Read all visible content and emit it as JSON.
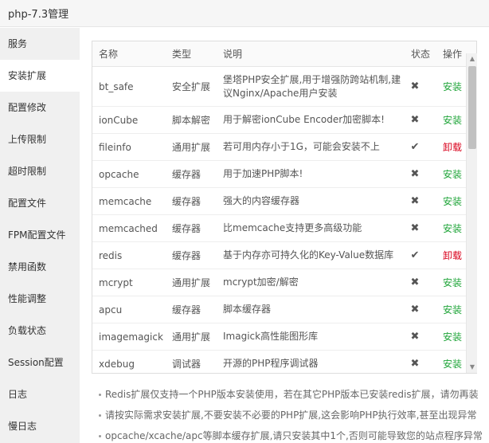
{
  "window": {
    "title": "php-7.3管理"
  },
  "sidebar": {
    "items": [
      {
        "label": "服务",
        "active": false
      },
      {
        "label": "安装扩展",
        "active": true
      },
      {
        "label": "配置修改",
        "active": false
      },
      {
        "label": "上传限制",
        "active": false
      },
      {
        "label": "超时限制",
        "active": false
      },
      {
        "label": "配置文件",
        "active": false
      },
      {
        "label": "FPM配置文件",
        "active": false
      },
      {
        "label": "禁用函数",
        "active": false
      },
      {
        "label": "性能调整",
        "active": false
      },
      {
        "label": "负载状态",
        "active": false
      },
      {
        "label": "Session配置",
        "active": false
      },
      {
        "label": "日志",
        "active": false
      },
      {
        "label": "慢日志",
        "active": false
      }
    ]
  },
  "table": {
    "headers": {
      "name": "名称",
      "type": "类型",
      "desc": "说明",
      "status": "状态",
      "op": "操作"
    },
    "rows": [
      {
        "name": "bt_safe",
        "type": "安全扩展",
        "desc": "堡塔PHP安全扩展,用于增强防跨站机制,建议Nginx/Apache用户安装",
        "status": "✖",
        "op": "安装",
        "installed": false
      },
      {
        "name": "ionCube",
        "type": "脚本解密",
        "desc": "用于解密ionCube Encoder加密脚本!",
        "status": "✖",
        "op": "安装",
        "installed": false
      },
      {
        "name": "fileinfo",
        "type": "通用扩展",
        "desc": "若可用内存小于1G，可能会安装不上",
        "status": "✔",
        "op": "卸载",
        "installed": true
      },
      {
        "name": "opcache",
        "type": "缓存器",
        "desc": "用于加速PHP脚本!",
        "status": "✖",
        "op": "安装",
        "installed": false
      },
      {
        "name": "memcache",
        "type": "缓存器",
        "desc": "强大的内容缓存器",
        "status": "✖",
        "op": "安装",
        "installed": false
      },
      {
        "name": "memcached",
        "type": "缓存器",
        "desc": "比memcache支持更多高级功能",
        "status": "✖",
        "op": "安装",
        "installed": false
      },
      {
        "name": "redis",
        "type": "缓存器",
        "desc": "基于内存亦可持久化的Key-Value数据库",
        "status": "✔",
        "op": "卸载",
        "installed": true
      },
      {
        "name": "mcrypt",
        "type": "通用扩展",
        "desc": "mcrypt加密/解密",
        "status": "✖",
        "op": "安装",
        "installed": false
      },
      {
        "name": "apcu",
        "type": "缓存器",
        "desc": "脚本缓存器",
        "status": "✖",
        "op": "安装",
        "installed": false
      },
      {
        "name": "imagemagick",
        "type": "通用扩展",
        "desc": "Imagick高性能图形库",
        "status": "✖",
        "op": "安装",
        "installed": false
      },
      {
        "name": "xdebug",
        "type": "调试器",
        "desc": "开源的PHP程序调试器",
        "status": "✖",
        "op": "安装",
        "installed": false
      }
    ]
  },
  "notes": [
    "Redis扩展仅支持一个PHP版本安装使用，若在其它PHP版本已安装redis扩展，请勿再装",
    "请按实际需求安装扩展,不要安装不必要的PHP扩展,这会影响PHP执行效率,甚至出现异常",
    "opcache/xcache/apc等脚本缓存扩展,请只安装其中1个,否则可能导致您的站点程序异常"
  ],
  "colors": {
    "install": "#20a53a",
    "uninstall": "#d9001b",
    "sidebar_bg": "#f0f0f0"
  }
}
